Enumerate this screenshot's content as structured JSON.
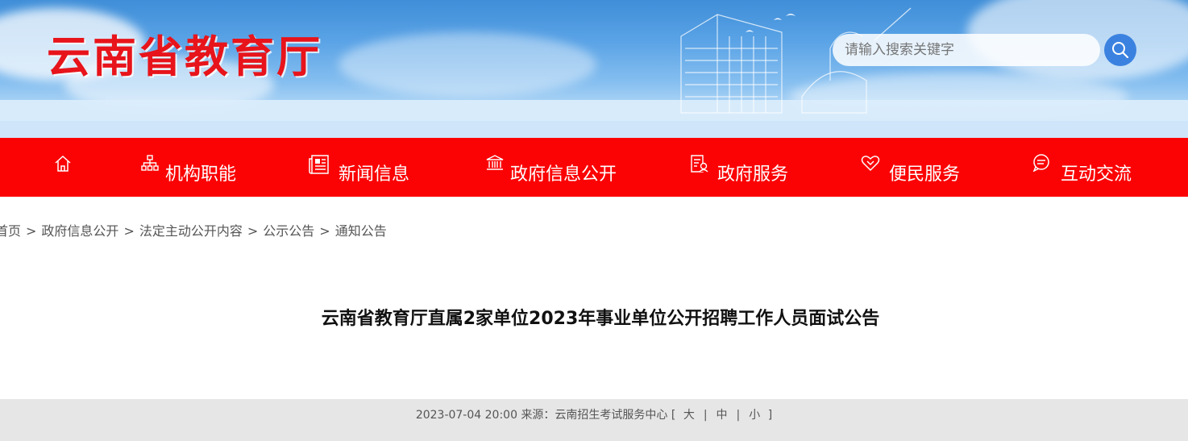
{
  "header": {
    "site_title": "云南省教育厅",
    "search": {
      "placeholder": "请输入搜索关键字"
    }
  },
  "nav": {
    "items": [
      {
        "icon": "home-icon",
        "label": ""
      },
      {
        "icon": "org-chart-icon",
        "label": "机构职能"
      },
      {
        "icon": "newspaper-icon",
        "label": "新闻信息"
      },
      {
        "icon": "government-building-icon",
        "label": "政府信息公开"
      },
      {
        "icon": "service-document-icon",
        "label": "政府服务"
      },
      {
        "icon": "handshake-heart-icon",
        "label": "便民服务"
      },
      {
        "icon": "chat-bubble-icon",
        "label": "互动交流"
      }
    ]
  },
  "breadcrumb": {
    "items": [
      "首页",
      "政府信息公开",
      "法定主动公开内容",
      "公示公告",
      "通知公告"
    ],
    "separator": ">"
  },
  "article": {
    "title": "云南省教育厅直属2家单位2023年事业单位公开招聘工作人员面试公告",
    "datetime": "2023-07-04 20:00",
    "source_label": "来源：",
    "source": "云南招生考试服务中心",
    "font_size_open": "[",
    "font_size_large": "大",
    "font_size_medium": "中",
    "font_size_small": "小",
    "font_size_close": "]",
    "divider": "|"
  },
  "colors": {
    "brand_red": "#fb0304",
    "title_red": "#e8141b",
    "search_blue": "#3b82e0"
  }
}
